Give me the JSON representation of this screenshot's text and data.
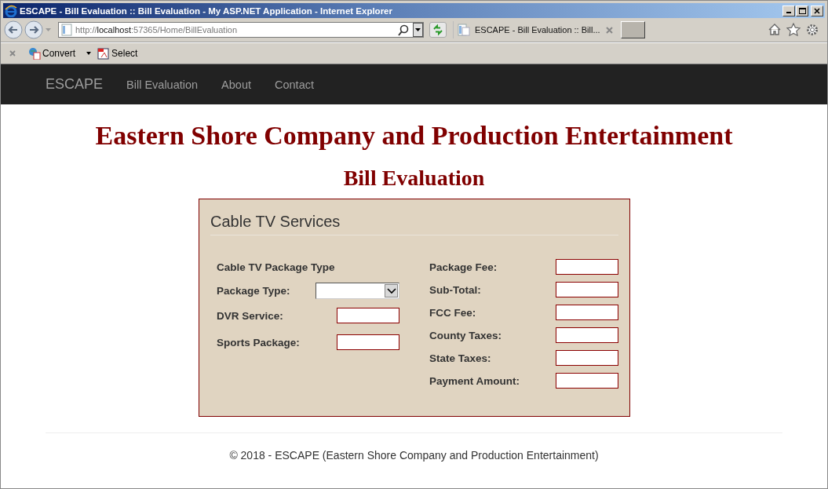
{
  "window": {
    "title": "ESCAPE - Bill Evaluation :: Bill Evaluation - My ASP.NET Application - Internet Explorer"
  },
  "address_bar": {
    "url_scheme": "http://",
    "url_host": "localhost",
    "url_path": ":57365/Home/BillEvaluation"
  },
  "tabs": [
    {
      "label": "ESCAPE - Bill Evaluation :: Bill...",
      "selected": true
    }
  ],
  "command_bar": {
    "buttons": [
      {
        "label": "Convert",
        "kind": "convert"
      },
      {
        "label": "Select",
        "kind": "select"
      }
    ]
  },
  "navbar": {
    "brand": "ESCAPE",
    "links": [
      "Bill Evaluation",
      "About",
      "Contact"
    ]
  },
  "page": {
    "heading": "Eastern Shore Company and Production Entertainment",
    "subheading": "Bill Evaluation"
  },
  "form": {
    "title": "Cable TV Services",
    "left": [
      {
        "kind": "heading",
        "label": "Cable TV Package Type"
      },
      {
        "kind": "select",
        "label": "Package Type:"
      },
      {
        "kind": "input",
        "label": "DVR Service:"
      },
      {
        "kind": "input",
        "label": "Sports Package:"
      }
    ],
    "right": [
      {
        "kind": "input",
        "label": "Package Fee:"
      },
      {
        "kind": "input",
        "label": "Sub-Total:"
      },
      {
        "kind": "input",
        "label": "FCC Fee:"
      },
      {
        "kind": "input",
        "label": "County Taxes:"
      },
      {
        "kind": "input",
        "label": "State Taxes:"
      },
      {
        "kind": "input",
        "label": "Payment Amount:"
      }
    ]
  },
  "footer": {
    "text": "© 2018 - ESCAPE (Eastern Shore Company and Production Entertainment)"
  }
}
